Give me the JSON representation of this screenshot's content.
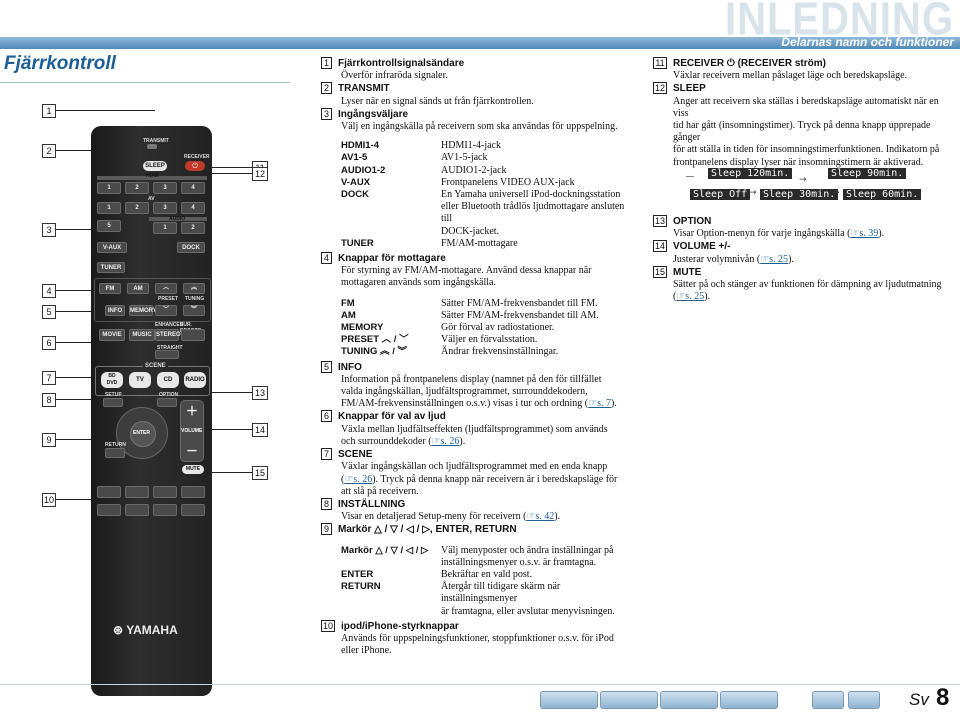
{
  "header": {
    "title": "INLEDNING",
    "subtitle": "Delarnas namn och funktioner"
  },
  "section_title": "Fjärrkontroll",
  "callouts_left": [
    "1",
    "2",
    "3",
    "4",
    "5",
    "6",
    "7",
    "8",
    "9",
    "10"
  ],
  "callouts_right": [
    "11",
    "12",
    "13",
    "14",
    "15"
  ],
  "remote": {
    "transmit": "TRANSMIT",
    "sleep": "SLEEP",
    "receiver": "RECEIVER",
    "hdmi": "HDMI",
    "av": "AV",
    "audio": "AUDIO",
    "vaux": "V-AUX",
    "dock": "DOCK",
    "tuner": "TUNER",
    "fm": "FM",
    "am": "AM",
    "info": "INFO",
    "memory": "MEMORY",
    "preset": "PRESET",
    "tuning": "TUNING",
    "movie": "MOVIE",
    "music": "MUSIC",
    "enhancer": "ENHANCER",
    "sur_decode": "SUR. DECODE",
    "stereo": "STEREO",
    "straight": "STRAIGHT",
    "scene": "SCENE",
    "bd_dvd": "BD\nDVD",
    "tv": "TV",
    "cd": "CD",
    "radio": "RADIO",
    "setup": "SETUP",
    "option": "OPTION",
    "enter": "ENTER",
    "return": "RETURN",
    "volume": "VOLUME",
    "mute": "MUTE",
    "brand": "YAMAHA",
    "hdmi_nums": [
      "1",
      "2",
      "3",
      "4"
    ],
    "av_nums": [
      "1",
      "2",
      "3",
      "4",
      "5"
    ],
    "audio_nums": [
      "1",
      "2"
    ]
  },
  "left_items": [
    {
      "num": "1",
      "title": "Fjärrkontrollsignalsändare",
      "text": "Överför infraröda signaler."
    },
    {
      "num": "2",
      "title": "TRANSMIT",
      "text": "Lyser när en signal sänds ut från fjärrkontrollen."
    },
    {
      "num": "3",
      "title": "Ingångsväljare",
      "text": "Välj en ingångskälla på receivern som ska användas för uppspelning."
    }
  ],
  "input_table": [
    {
      "k": "HDMI1-4",
      "v": "HDMI1-4-jack"
    },
    {
      "k": "AV1-5",
      "v": "AV1-5-jack"
    },
    {
      "k": "AUDIO1-2",
      "v": "AUDIO1-2-jack"
    },
    {
      "k": "V-AUX",
      "v": "Frontpanelens VIDEO AUX-jack"
    },
    {
      "k": "DOCK",
      "v": "En Yamaha universell iPod-dockningsstation"
    },
    {
      "k": "",
      "v": "eller Bluetooth trådlös ljudmottagare ansluten till"
    },
    {
      "k": "",
      "v": "DOCK-jacket."
    },
    {
      "k": "TUNER",
      "v": "FM/AM-mottagare"
    }
  ],
  "item4": {
    "num": "4",
    "title": "Knappar för mottagare",
    "text1": "För styrning av FM/AM-mottagare. Använd dessa knappar när",
    "text2": "mottagaren används som ingångskälla."
  },
  "tuner_table": [
    {
      "k": "FM",
      "v": "Sätter FM/AM-frekvensbandet till FM."
    },
    {
      "k": "AM",
      "v": "Sätter FM/AM-frekvensbandet till AM."
    },
    {
      "k": "MEMORY",
      "v": "Gör förval av radiostationer."
    },
    {
      "k": "PRESET ︿ / ﹀",
      "v": "Väljer en förvalsstation."
    },
    {
      "k": "TUNING ︽ / ︾",
      "v": "Ändrar frekvensinställningar."
    }
  ],
  "item5": {
    "num": "5",
    "title": "INFO",
    "l1": "Information på frontpanelens display (namnet på den för tillfället",
    "l2": "valda ingångskällan, ljudfältsprogrammet, surrounddekodern,",
    "l3": "FM/AM-frekvensinställningen o.s.v.) visas i tur och ordning (",
    "l3ref": "☞s. 7",
    "l3end": ")."
  },
  "item6": {
    "num": "6",
    "title": "Knappar för val av ljud",
    "l1": "Växla mellan ljudfältseffekten (ljudfältsprogrammet) som används",
    "l2": "och surrounddekoder (",
    "ref": "☞s. 26",
    "l2end": ")."
  },
  "item7": {
    "num": "7",
    "title": "SCENE",
    "l1": "Växlar ingångskällan och ljudfältsprogrammet med en enda knapp",
    "l2a": "(",
    "ref": "☞s. 26",
    "l2b": "). Tryck på denna knapp när receivern är i beredskapsläge för",
    "l3": "att slå på receivern."
  },
  "item8": {
    "num": "8",
    "title": "INSTÄLLNING",
    "l1": "Visar en detaljerad Setup-meny för receivern (",
    "ref": "☞s. 42",
    "l1end": ")."
  },
  "item9": {
    "num": "9",
    "title": "Markör △ / ▽ / ◁ / ▷, ENTER, RETURN"
  },
  "cursor_table": [
    {
      "k": "Markör △ / ▽ / ◁ / ▷",
      "v": "Välj menyposter och ändra inställningar på"
    },
    {
      "k": "",
      "v": "inställningsmenyer o.s.v. är framtagna."
    },
    {
      "k": "ENTER",
      "v": "Bekräftar en vald post."
    },
    {
      "k": "RETURN",
      "v": "Återgår till tidigare skärm när inställningsmenyer"
    },
    {
      "k": "",
      "v": "är framtagna, eller avslutar menyvisningen."
    }
  ],
  "item10": {
    "num": "10",
    "title": "ipod/iPhone-styrknappar",
    "l1": "Används för uppspelningsfunktioner, stoppfunktioner o.s.v. för iPod",
    "l2": "eller iPhone."
  },
  "item11": {
    "num": "11",
    "title": "RECEIVER ⏻ (RECEIVER ström)",
    "text": "Växlar receivern mellan påslaget läge och beredskapsläge."
  },
  "item12": {
    "num": "12",
    "title": "SLEEP",
    "l1": "Anger att receivern ska ställas i beredskapsläge automatiskt när en viss",
    "l2": "tid har gått (insomningstimer). Tryck på denna knapp upprepade gånger",
    "l3": "för att ställa in tiden för insomningstimerfunktionen. Indikatorn på",
    "l4": "frontpanelens display lyser när insomningstimern är aktiverad."
  },
  "sleep_displays": [
    "Sleep 120min.",
    "Sleep 90min.",
    "Sleep Off",
    "Sleep 30min.",
    "Sleep 60min."
  ],
  "item13": {
    "num": "13",
    "title": "OPTION",
    "text": "Visar Option-menyn för varje ingångskälla (",
    "ref": "☞s. 39",
    "end": ")."
  },
  "item14": {
    "num": "14",
    "title": "VOLUME +/-",
    "text": "Justerar volymnivån (",
    "ref": "☞s. 25",
    "end": ")."
  },
  "item15": {
    "num": "15",
    "title": "MUTE",
    "l1": "Sätter på och stänger av funktionen för dämpning av ljudutmatning",
    "l2a": "(",
    "ref": "☞s. 25",
    "l2b": ")."
  },
  "footer": {
    "lang": "Sv",
    "page": "8"
  }
}
